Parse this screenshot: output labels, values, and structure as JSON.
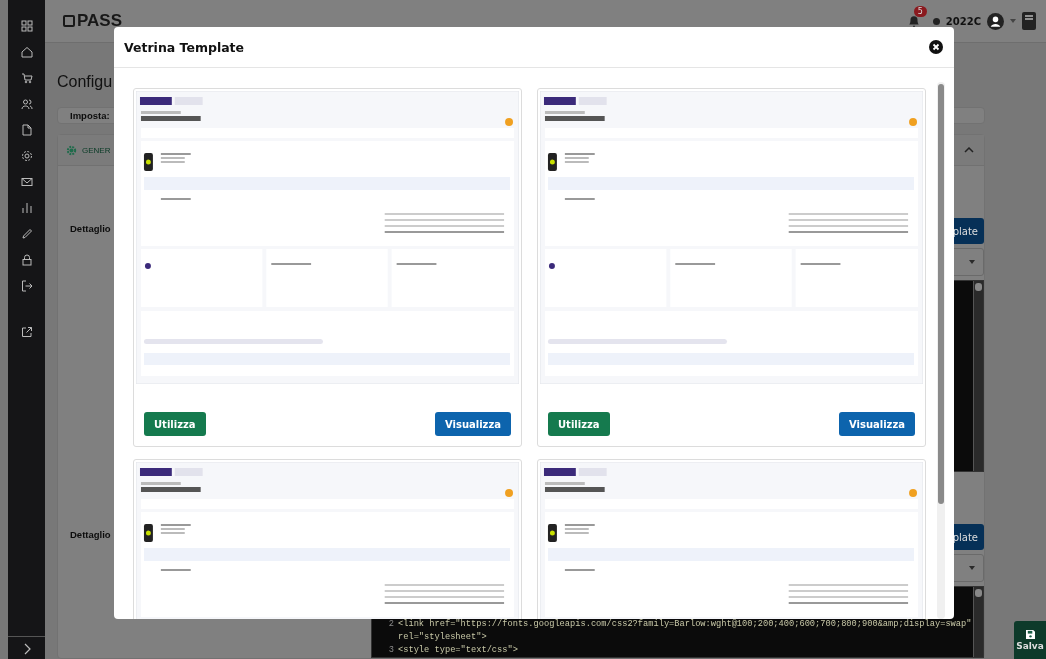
{
  "topbar": {
    "logo": "PASS",
    "notification_count": "5",
    "user": "2022C"
  },
  "page": {
    "title": "Configu",
    "settings_card": {
      "title": "Imposta:"
    },
    "section": {
      "tab": "GENER",
      "fields": [
        {
          "label": "Dettaglio",
          "button": "plate"
        },
        {
          "label": "Dettaglio",
          "button": "plate",
          "code_lines": [
            {
              "number": "2",
              "text": "<link href=\"https://fonts.googleapis.com/css2?family=Barlow:wght@100;200;400;600;700;800;900&amp;display=swap\""
            },
            {
              "text": "rel=\"stylesheet\">"
            },
            {
              "number": "3",
              "text": "<style type=\"text/css\">"
            }
          ]
        }
      ]
    },
    "save_button": "Salva"
  },
  "modal": {
    "title": "Vetrina Template",
    "templates": [
      {
        "kind": "full",
        "use_button": "Utilizza",
        "view_button": "Visualizza"
      },
      {
        "kind": "full",
        "use_button": "Utilizza",
        "view_button": "Visualizza"
      },
      {
        "kind": "cut"
      },
      {
        "kind": "cut"
      }
    ]
  }
}
